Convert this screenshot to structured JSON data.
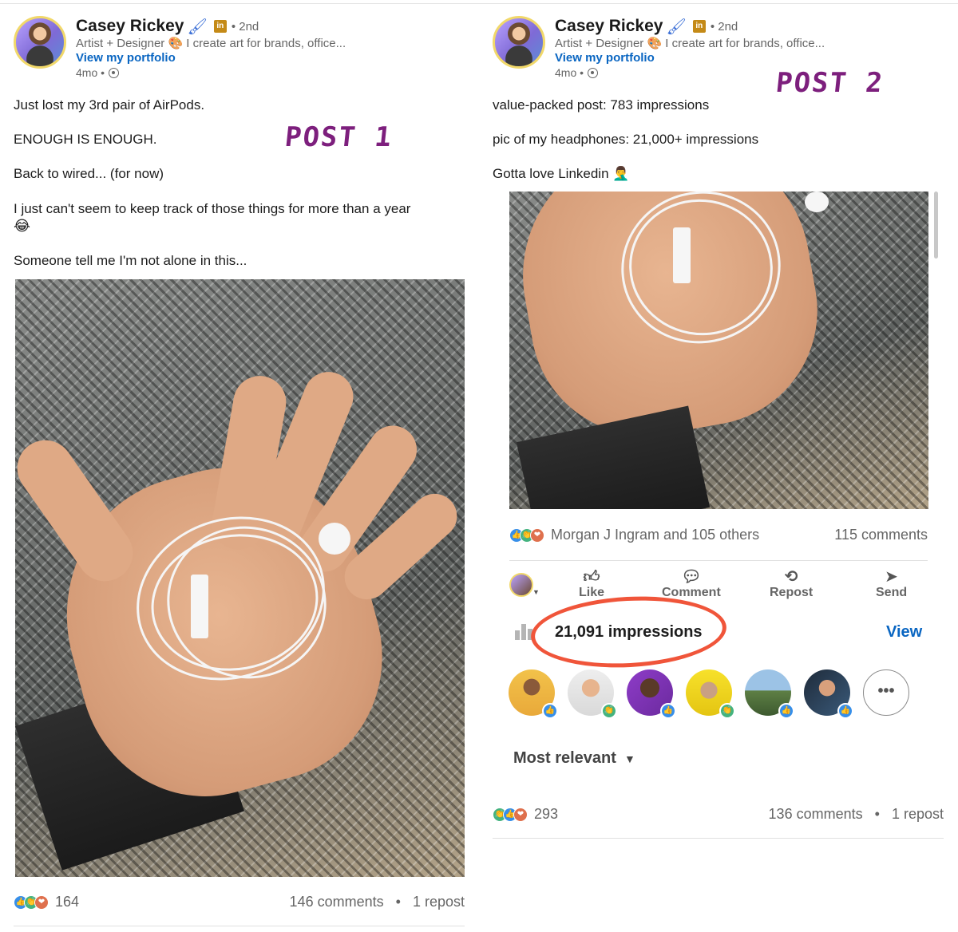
{
  "posts": [
    {
      "label": "POST 1",
      "author": {
        "name": "Casey Rickey",
        "degree": "• 2nd",
        "headline": "Artist + Designer 🎨 I create art for brands, office...",
        "portfolio_link": "View my portfolio",
        "time": "4mo •"
      },
      "body": [
        "Just lost my 3rd pair of AirPods.",
        "ENOUGH IS ENOUGH.",
        "Back to wired... (for now)",
        "I just can't seem to keep track of those things for more than a year",
        "😂",
        "Someone tell me I'm not alone in this..."
      ],
      "reaction_count": "164",
      "comments": "146 comments",
      "reposts": "1 repost",
      "separator": "•"
    },
    {
      "label": "POST 2",
      "author": {
        "name": "Casey Rickey",
        "degree": "• 2nd",
        "headline": "Artist + Designer 🎨 I create art for brands, office...",
        "portfolio_link": "View my portfolio",
        "time": "4mo •"
      },
      "body": [
        "value-packed post: 783 impressions",
        "pic of my headphones: 21,000+ impressions",
        "Gotta love Linkedin 🤦‍♂️"
      ],
      "reactors_summary": "Morgan J Ingram and 105 others",
      "comments_top": "115 comments",
      "actions": [
        "Like",
        "Comment",
        "Repost",
        "Send"
      ],
      "impressions": "21,091 impressions",
      "view_link": "View",
      "sort_label": "Most relevant",
      "reaction_count": "293",
      "comments": "136 comments",
      "reposts": "1 repost",
      "separator": "•"
    }
  ],
  "colors": {
    "link_blue": "#0a66c2",
    "annotation_purple": "#7d1f7d",
    "annotation_red": "#f0553a",
    "like_blue": "#378fe9",
    "celebrate_green": "#44b37f",
    "love_red": "#df704d"
  },
  "icons": {
    "like": "thumbs-up-icon",
    "comment": "speech-bubble-icon",
    "repost": "repost-arrows-icon",
    "send": "paper-plane-icon",
    "visibility": "globe-icon",
    "impressions": "bar-chart-icon",
    "more": "ellipsis-icon"
  }
}
